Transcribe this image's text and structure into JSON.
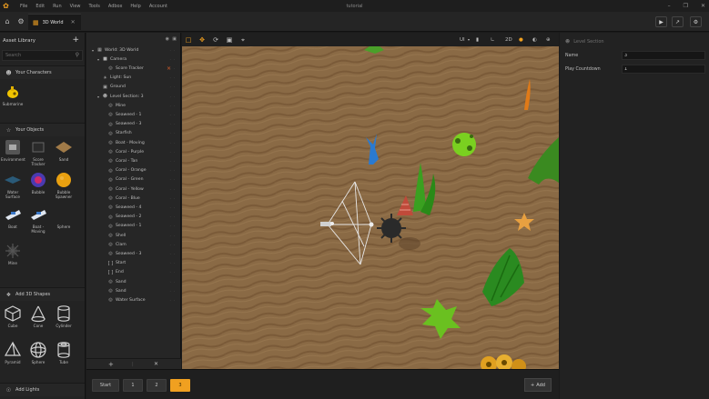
{
  "menu": {
    "items": [
      "File",
      "Edit",
      "Run",
      "View",
      "Tools",
      "Adbox",
      "Help",
      "Account"
    ],
    "window_title": "tutorial"
  },
  "tab": {
    "label": "3D World"
  },
  "asset_library": {
    "title": "Asset Library",
    "search_placeholder": "Search",
    "characters_heading": "Your Characters",
    "characters": [
      {
        "label": "Submarine",
        "icon": "submarine-icon"
      }
    ],
    "objects_heading": "Your Objects",
    "objects": [
      {
        "label": "Environment",
        "icon": "environment-icon"
      },
      {
        "label": "Score Tracker",
        "icon": "score-tracker-icon"
      },
      {
        "label": "Sand",
        "icon": "sand-icon"
      },
      {
        "label": "Water Surface",
        "icon": "water-surface-icon"
      },
      {
        "label": "Bubble",
        "icon": "bubble-icon"
      },
      {
        "label": "Bubble Spawner",
        "icon": "bubble-spawner-icon"
      },
      {
        "label": "Boat",
        "icon": "boat-icon"
      },
      {
        "label": "Boat - Moving",
        "icon": "boat-moving-icon"
      },
      {
        "label": "Sphere",
        "icon": "sphere-icon"
      },
      {
        "label": "Mine",
        "icon": "mine-icon"
      }
    ],
    "shapes_heading": "Add 3D Shapes",
    "shapes": [
      {
        "label": "Cube",
        "icon": "cube-icon"
      },
      {
        "label": "Cone",
        "icon": "cone-icon"
      },
      {
        "label": "Cylinder",
        "icon": "cylinder-icon"
      },
      {
        "label": "Pyramid",
        "icon": "pyramid-icon"
      },
      {
        "label": "Sphere",
        "icon": "sphere-icon"
      },
      {
        "label": "Tube",
        "icon": "tube-icon"
      }
    ],
    "lights_heading": "Add Lights"
  },
  "hierarchy": {
    "items": [
      {
        "label": "World: 3D World",
        "icon": "world-icon",
        "depth": 0,
        "expanded": true
      },
      {
        "label": "Camera",
        "icon": "camera-icon",
        "depth": 1,
        "expanded": true
      },
      {
        "label": "Score Tracker",
        "icon": "object-icon",
        "depth": 2,
        "flag": "×"
      },
      {
        "label": "Light: Sun",
        "icon": "sun-icon",
        "depth": 1
      },
      {
        "label": "Ground",
        "icon": "ground-icon",
        "depth": 1
      },
      {
        "label": "Level Section: 3",
        "icon": "level-icon",
        "depth": 1,
        "expanded": true
      },
      {
        "label": "Mine",
        "icon": "object-icon",
        "depth": 2
      },
      {
        "label": "Seaweed - 1",
        "icon": "object-icon",
        "depth": 2
      },
      {
        "label": "Seaweed - 3",
        "icon": "object-icon",
        "depth": 2
      },
      {
        "label": "Starfish",
        "icon": "object-icon",
        "depth": 2
      },
      {
        "label": "Boat - Moving",
        "icon": "object-icon",
        "depth": 2
      },
      {
        "label": "Coral - Purple",
        "icon": "object-icon",
        "depth": 2
      },
      {
        "label": "Coral - Tan",
        "icon": "object-icon",
        "depth": 2
      },
      {
        "label": "Coral - Orange",
        "icon": "object-icon",
        "depth": 2
      },
      {
        "label": "Coral - Green",
        "icon": "object-icon",
        "depth": 2
      },
      {
        "label": "Coral - Yellow",
        "icon": "object-icon",
        "depth": 2
      },
      {
        "label": "Coral - Blue",
        "icon": "object-icon",
        "depth": 2
      },
      {
        "label": "Seaweed - 4",
        "icon": "object-icon",
        "depth": 2
      },
      {
        "label": "Seaweed - 2",
        "icon": "object-icon",
        "depth": 2
      },
      {
        "label": "Seaweed - 1",
        "icon": "object-icon",
        "depth": 2
      },
      {
        "label": "Shell",
        "icon": "object-icon",
        "depth": 2
      },
      {
        "label": "Clam",
        "icon": "object-icon",
        "depth": 2
      },
      {
        "label": "Seaweed - 3",
        "icon": "object-icon",
        "depth": 2
      },
      {
        "label": "Start",
        "icon": "bracket-icon",
        "depth": 2
      },
      {
        "label": "End",
        "icon": "bracket-icon",
        "depth": 2
      },
      {
        "label": "Sand",
        "icon": "object-icon",
        "depth": 2
      },
      {
        "label": "Sand",
        "icon": "object-icon",
        "depth": 2
      },
      {
        "label": "Water Surface",
        "icon": "object-icon",
        "depth": 2
      }
    ]
  },
  "viewport": {
    "view_mode_label": "UI",
    "dimension_label": "2D"
  },
  "sections": {
    "buttons": [
      "Start",
      "1",
      "2",
      "3"
    ],
    "active": "3",
    "add_label": "Add"
  },
  "properties": {
    "title": "Level Section",
    "fields": [
      {
        "label": "Name",
        "value": "3"
      },
      {
        "label": "Play Countdown",
        "value": "1"
      }
    ]
  },
  "colors": {
    "accent": "#f0a020",
    "sand": "#8a6a45",
    "panel": "#232323"
  }
}
